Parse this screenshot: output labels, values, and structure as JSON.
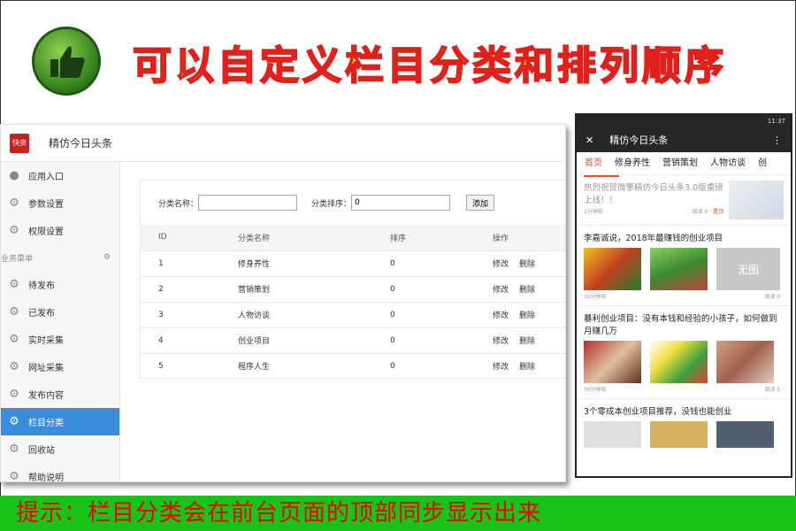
{
  "headline": "可以自定义栏目分类和排列顺序",
  "admin": {
    "logo": "快资",
    "title": "精仿今日头条",
    "sidebar": [
      {
        "label": "应用入口",
        "icon": "chat-icon"
      },
      {
        "label": "参数设置",
        "icon": "gear-icon"
      },
      {
        "label": "权限设置",
        "icon": "gear-icon"
      }
    ],
    "group_label": "业务菜单",
    "menu": [
      {
        "label": "待发布",
        "icon": "gear-icon"
      },
      {
        "label": "已发布",
        "icon": "gear-icon"
      },
      {
        "label": "实时采集",
        "icon": "gear-icon"
      },
      {
        "label": "网址采集",
        "icon": "gear-icon"
      },
      {
        "label": "发布内容",
        "icon": "gear-icon"
      },
      {
        "label": "栏目分类",
        "icon": "gear-icon"
      },
      {
        "label": "回收站",
        "icon": "gear-icon"
      },
      {
        "label": "帮助说明",
        "icon": "gear-icon"
      }
    ],
    "active_menu": "栏目分类",
    "form": {
      "name_label": "分类名称：",
      "name_value": "",
      "order_label": "分类排序：",
      "order_value": "0",
      "add_label": "添加"
    },
    "table": {
      "headers": [
        "ID",
        "分类名称",
        "排序",
        "操作"
      ],
      "rows": [
        {
          "id": "1",
          "name": "修身养性",
          "order": "0"
        },
        {
          "id": "2",
          "name": "营销策划",
          "order": "0"
        },
        {
          "id": "3",
          "name": "人物访谈",
          "order": "0"
        },
        {
          "id": "4",
          "name": "创业项目",
          "order": "0"
        },
        {
          "id": "5",
          "name": "程序人生",
          "order": "0"
        }
      ],
      "edit": "修改",
      "delete": "删除"
    }
  },
  "phone": {
    "time": "11:37",
    "title": "精仿今日头条",
    "tabs": [
      "首页",
      "修身养性",
      "营销策划",
      "人物访谈",
      "创"
    ],
    "news": [
      {
        "title": "热烈祝贺微擎精仿今日头条3.0版重磅上线！！",
        "time": "1分钟前",
        "reads": "阅读 0 ·",
        "tag": "置顶"
      },
      {
        "title": "李嘉诚说，2018年最赚钱的创业项目",
        "time": "30分钟前",
        "reads": "阅读 0 ·",
        "noimg": "无图"
      },
      {
        "title": "暴利创业项目：没有本钱和经验的小孩子，如何做到月赚几万",
        "time": "30分钟前",
        "reads": "阅读 0 ·"
      },
      {
        "title": "3个零成本创业项目推荐，没钱也能创业"
      }
    ]
  },
  "tip": "提示：栏目分类会在前台页面的顶部同步显示出来"
}
